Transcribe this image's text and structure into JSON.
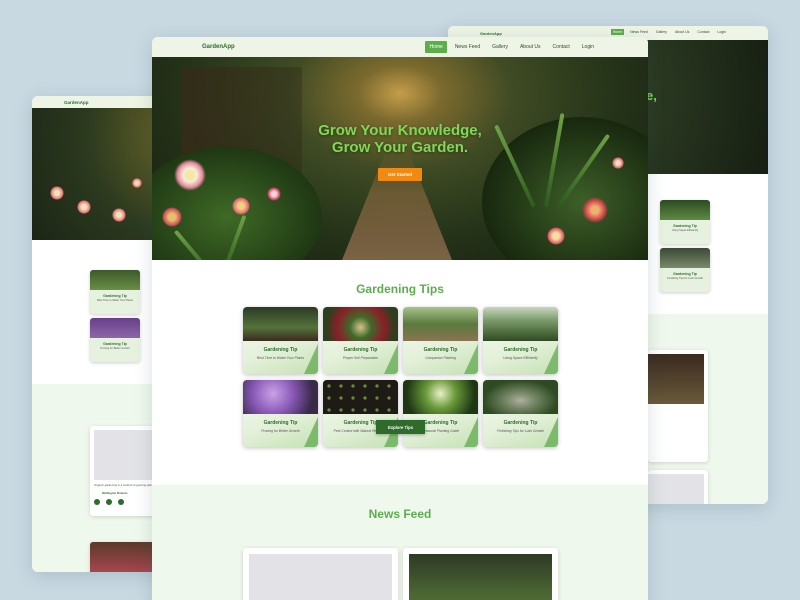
{
  "app": {
    "brand": "GardenApp"
  },
  "nav": {
    "items": [
      {
        "label": "Home",
        "active": true
      },
      {
        "label": "News Feed",
        "active": false
      },
      {
        "label": "Gallery",
        "active": false
      },
      {
        "label": "About Us",
        "active": false
      },
      {
        "label": "Contact",
        "active": false
      },
      {
        "label": "Login",
        "active": false
      }
    ]
  },
  "hero": {
    "title_line1": "Grow Your Knowledge,",
    "title_line2": "Grow Your Garden.",
    "cta_label": "Get Started"
  },
  "tips": {
    "section_title": "Gardening Tips",
    "cards": [
      {
        "title": "Gardening Tip",
        "subtitle": "Best Time to Water Your Plants",
        "image": "seedlings"
      },
      {
        "title": "Gardening Tip",
        "subtitle": "Proper Soil Preparation",
        "image": "rose-arch"
      },
      {
        "title": "Gardening Tip",
        "subtitle": "Companion Planting",
        "image": "garden-path"
      },
      {
        "title": "Gardening Tip",
        "subtitle": "Using Space Efficiently",
        "image": "greenhouse"
      },
      {
        "title": "Gardening Tip",
        "subtitle": "Pruning for Better Growth",
        "image": "purple-tree"
      },
      {
        "title": "Gardening Tip",
        "subtitle": "Pest Control with Natural Remedies",
        "image": "seed-trays"
      },
      {
        "title": "Gardening Tip",
        "subtitle": "Seasonal Planting Guide",
        "image": "forest-trail"
      },
      {
        "title": "Gardening Tip",
        "subtitle": "Fertilizing Tips for Lush Growth",
        "image": "fountain"
      }
    ],
    "explore_label": "Explore Tips"
  },
  "feed": {
    "section_title": "News Feed"
  },
  "left_screen": {
    "feed_author": "Wellington Roberts",
    "feed_excerpt": "Organic gardening is a method of growing plants..."
  },
  "right_screen": {
    "nav": [
      "Home",
      "News Feed",
      "Gallery",
      "About Us",
      "Contact",
      "Login"
    ],
    "hero_fragment": "e,",
    "tip_title": "Gardening Tip",
    "tip_subs": [
      "Using Space Efficiently",
      "Fertilizing Tips for Lush Growth"
    ]
  },
  "colors": {
    "brand_green": "#2f6b2a",
    "accent_green": "#5cae4d",
    "hero_text": "#7ed957",
    "cta_orange": "#f28a12",
    "feed_bg": "#eff8ec"
  }
}
